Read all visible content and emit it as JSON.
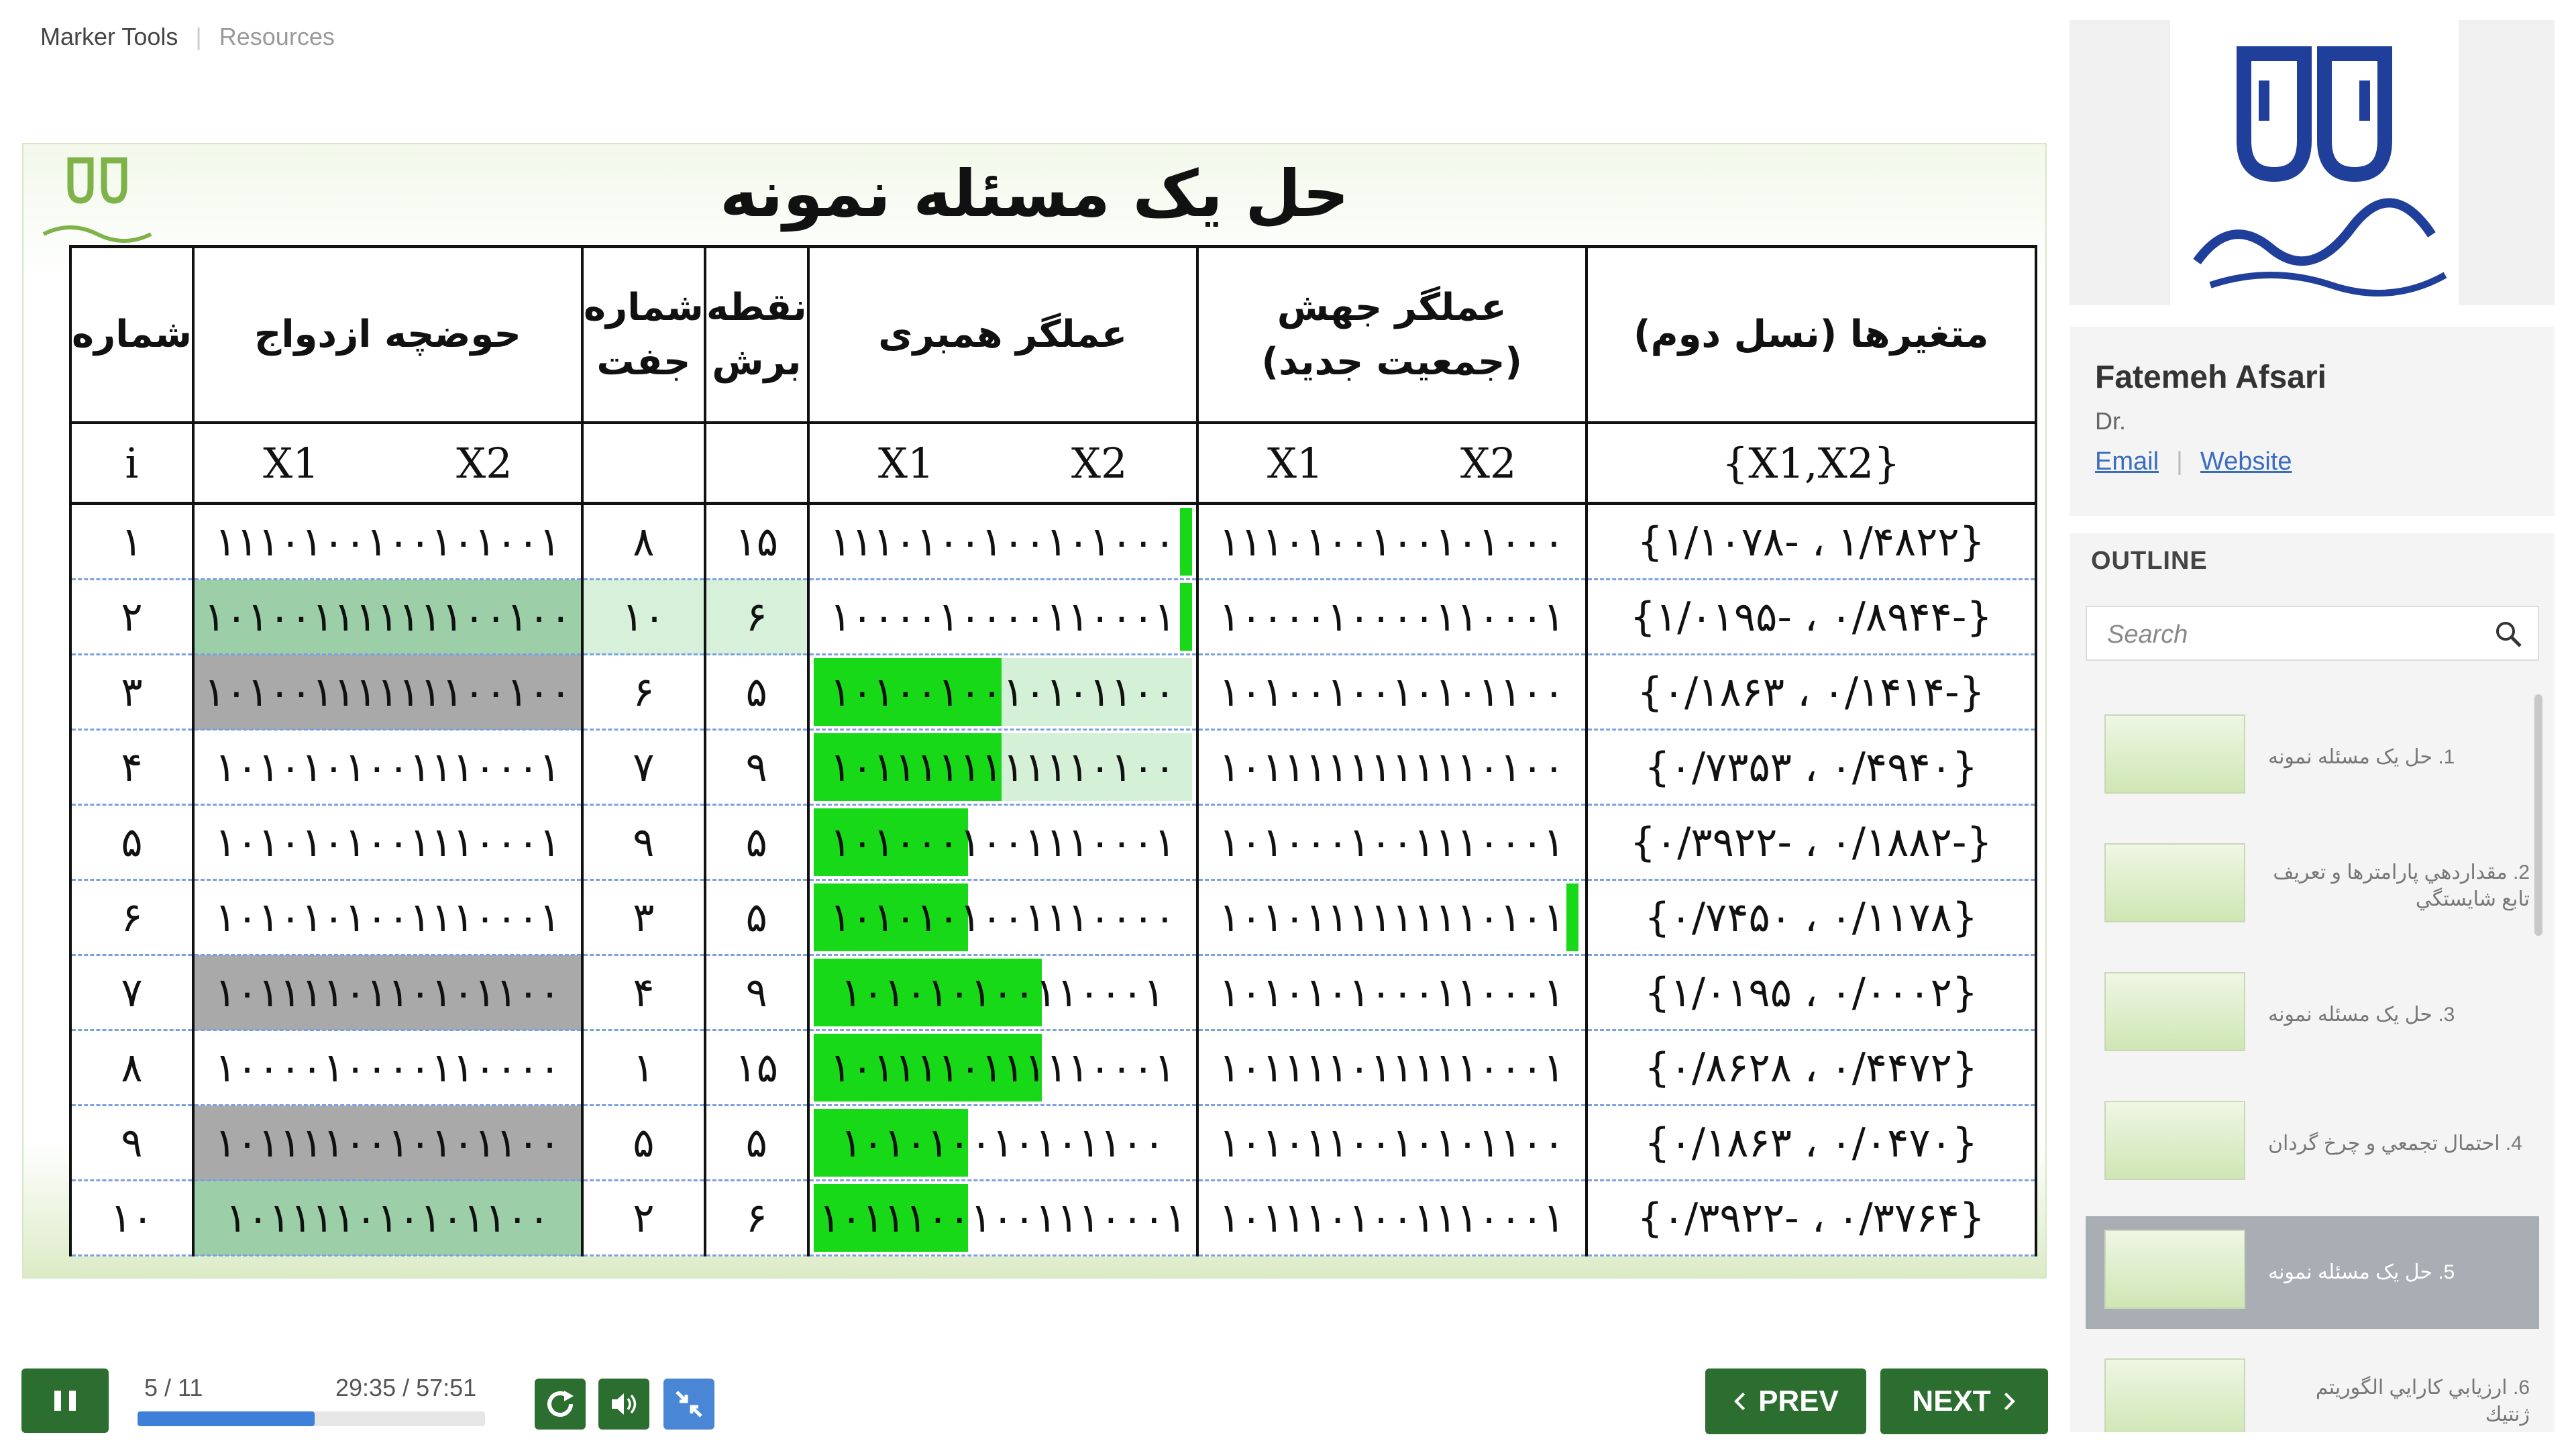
{
  "topnav": {
    "items": [
      "Marker Tools",
      "Resources"
    ]
  },
  "slide": {
    "title": "حل یک مسئله نمونه",
    "table": {
      "headers": {
        "index": "شماره",
        "parents": "حوضچه ازدواج",
        "pair": "شماره جفت",
        "cut": "نقطه برش",
        "crossover": "عملگر همبری",
        "mutation": "عملگر جهش (جمعیت جدید)",
        "vars": "متغیرها (نسل دوم)"
      },
      "subheaders": {
        "index": "i",
        "x1": "X1",
        "x2": "X2",
        "vars": "{X1,X2}"
      },
      "rows": [
        {
          "i": "۱",
          "parent": "۱۱۱۰۱۰۰۱۰۰۱۰۱۰۰۱",
          "pair": "۸",
          "cut": "۱۵",
          "cross": "۱۱۱۰۱۰۰۱۰۰۱۰۱۰۰۰",
          "mut": "۱۱۱۰۱۰۰۱۰۰۱۰۱۰۰۰",
          "vars": "{۱/۴۸۲۲ ، -۱/۱۰۷۸}"
        },
        {
          "i": "۲",
          "parent": "۱۰۱۰۰۱۱۱۱۱۱۱۰۰۱۰۰",
          "pair": "۱۰",
          "cut": "۶",
          "cross": "۱۰۰۰۰۱۰۰۰۰۱۱۰۰۰۱",
          "mut": "۱۰۰۰۰۱۰۰۰۰۱۱۰۰۰۱",
          "vars": "{-۰/۸۹۴۴ ، -۱/۰۱۹۵}"
        },
        {
          "i": "۳",
          "parent": "۱۰۱۰۰۱۱۱۱۱۱۱۰۰۱۰۰",
          "pair": "۶",
          "cut": "۵",
          "cross": "۱۰۱۰۰۱۰۰۱۰۱۰۱۱۰۰",
          "mut": "۱۰۱۰۰۱۰۰۱۰۱۰۱۱۰۰",
          "vars": "{-۰/۱۴۱۴ ، ۰/۱۸۶۳}"
        },
        {
          "i": "۴",
          "parent": "۱۰۱۰۱۰۱۰۰۱۱۱۰۰۰۱",
          "pair": "۷",
          "cut": "۹",
          "cross": "۱۰۱۱۱۱۱۱۱۱۱۱۰۱۰۰",
          "mut": "۱۰۱۱۱۱۱۱۱۱۱۱۰۱۰۰",
          "vars": "{۰/۴۹۴۰ ، ۰/۷۳۵۳}"
        },
        {
          "i": "۵",
          "parent": "۱۰۱۰۱۰۱۰۰۱۱۱۰۰۰۱",
          "pair": "۹",
          "cut": "۵",
          "cross": "۱۰۱۰۰۰۱۰۰۱۱۱۰۰۰۱",
          "mut": "۱۰۱۰۰۰۱۰۰۱۱۱۰۰۰۱",
          "vars": "{-۰/۱۸۸۲ ، -۰/۳۹۲۲}"
        },
        {
          "i": "۶",
          "parent": "۱۰۱۰۱۰۱۰۰۱۱۱۰۰۰۱",
          "pair": "۳",
          "cut": "۵",
          "cross": "۱۰۱۰۱۰۱۰۰۱۱۱۰۰۰۰",
          "mut": "۱۰۱۰۱۱۱۱۱۱۱۱۰۱۰۱",
          "vars": "{۰/۱۱۷۸ ، ۰/۷۴۵۰}"
        },
        {
          "i": "۷",
          "parent": "۱۰۱۱۱۱۰۱۱۰۱۰۱۱۰۰",
          "pair": "۴",
          "cut": "۹",
          "cross": "۱۰۱۰۱۰۱۰۰۱۱۰۰۰۱",
          "mut": "۱۰۱۰۱۰۱۰۰۰۱۱۰۰۰۱",
          "vars": "{۰/۰۰۰۲ ، ۱/۰۱۹۵}"
        },
        {
          "i": "۸",
          "parent": "۱۰۰۰۰۱۰۰۰۰۱۱۰۰۰۰",
          "pair": "۱",
          "cut": "۱۵",
          "cross": "۱۰۱۱۱۱۰۱۱۱۱۱۰۰۰۱",
          "mut": "۱۰۱۱۱۱۰۱۱۱۱۱۰۰۰۱",
          "vars": "{۰/۴۴۷۲ ، ۰/۸۶۲۸}"
        },
        {
          "i": "۹",
          "parent": "۱۰۱۱۱۱۰۰۱۰۱۰۱۱۰۰",
          "pair": "۵",
          "cut": "۵",
          "cross": "۱۰۱۰۱۰۰۱۰۱۰۱۱۰۰",
          "mut": "۱۰۱۰۱۱۰۰۱۰۱۰۱۱۰۰",
          "vars": "{۰/۰۴۷۰ ، ۰/۱۸۶۳}"
        },
        {
          "i": "۱۰",
          "parent": "۱۰۱۱۱۱۰۱۰۱۰۱۱۰۰",
          "pair": "۲",
          "cut": "۶",
          "cross": "۱۰۱۱۱۰۰۱۰۰۱۱۱۰۰۰۱",
          "mut": "۱۰۱۱۱۰۱۰۰۱۱۱۰۰۰۱",
          "vars": "{۰/۳۷۶۴ ، -۰/۳۹۲۲}"
        }
      ]
    }
  },
  "presenter": {
    "name": "Fatemeh Afsari",
    "title": "Dr.",
    "links": [
      "Email",
      "Website"
    ]
  },
  "outline": {
    "heading": "OUTLINE",
    "search_placeholder": "Search",
    "items": [
      "1. حل یک مسئله نمونه",
      "2. مقداردهي پارامترها و تعريف تابع شايستگي",
      "3. حل یک مسئله نمونه",
      "4. احتمال تجمعي و چرخ گردان",
      "5. حل یک مسئله نمونه",
      "6. ارزيابي كارايي الگوريتم ژنتيك"
    ],
    "active_index": 4
  },
  "player": {
    "slide_counter": "5 / 11",
    "time": "29:35 / 57:51",
    "progress_fraction": 0.51,
    "prev_label": "PREV",
    "next_label": "NEXT"
  },
  "colors": {
    "accent_green": "#2c6e2f",
    "progress_blue": "#3d7fd9",
    "highlight_green": "#17d917"
  },
  "icons": [
    "pause-icon",
    "replay-icon",
    "volume-icon",
    "collapse-icon",
    "search-icon",
    "chevron-left-icon",
    "chevron-right-icon"
  ]
}
